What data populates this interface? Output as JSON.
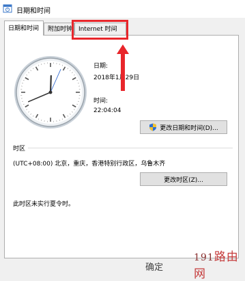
{
  "window": {
    "title": "日期和时间"
  },
  "tabs": [
    {
      "label": "日期和时间",
      "active": true
    },
    {
      "label": "附加时钟",
      "active": false
    },
    {
      "label": "Internet 时间",
      "active": false
    }
  ],
  "datetime": {
    "date_label": "日期:",
    "date_value": "2018年1月29日",
    "time_label": "时间:",
    "time_value": "22:04:04",
    "change_datetime_button": "更改日期和时间(D)..."
  },
  "timezone": {
    "section_label": "时区",
    "value": "(UTC+08:00) 北京，重庆，香港特别行政区，乌鲁木齐",
    "change_timezone_button": "更改时区(Z)...",
    "dst_note": "此时区未实行夏令时。"
  },
  "footer": {
    "ok_label": "确定"
  },
  "watermark": {
    "number": "191",
    "text": "路由网"
  },
  "colors": {
    "highlight": "#e8262b",
    "panel": "#ffffff",
    "window": "#f0f0f0"
  },
  "icons": [
    "datetime-window-icon",
    "uac-shield-icon",
    "analog-clock"
  ]
}
